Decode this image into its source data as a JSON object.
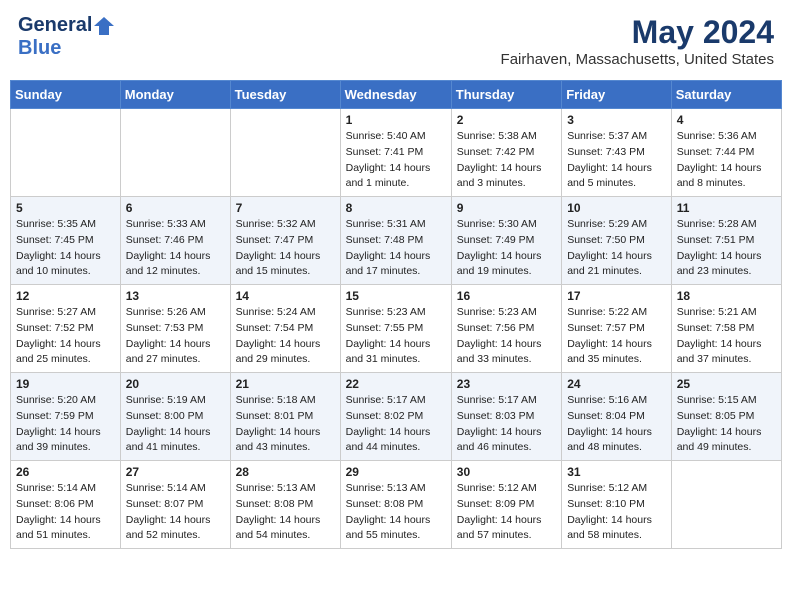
{
  "header": {
    "logo_line1": "General",
    "logo_line2": "Blue",
    "title": "May 2024",
    "subtitle": "Fairhaven, Massachusetts, United States"
  },
  "days_of_week": [
    "Sunday",
    "Monday",
    "Tuesday",
    "Wednesday",
    "Thursday",
    "Friday",
    "Saturday"
  ],
  "weeks": [
    [
      {
        "day": "",
        "info": ""
      },
      {
        "day": "",
        "info": ""
      },
      {
        "day": "",
        "info": ""
      },
      {
        "day": "1",
        "info": "Sunrise: 5:40 AM\nSunset: 7:41 PM\nDaylight: 14 hours\nand 1 minute."
      },
      {
        "day": "2",
        "info": "Sunrise: 5:38 AM\nSunset: 7:42 PM\nDaylight: 14 hours\nand 3 minutes."
      },
      {
        "day": "3",
        "info": "Sunrise: 5:37 AM\nSunset: 7:43 PM\nDaylight: 14 hours\nand 5 minutes."
      },
      {
        "day": "4",
        "info": "Sunrise: 5:36 AM\nSunset: 7:44 PM\nDaylight: 14 hours\nand 8 minutes."
      }
    ],
    [
      {
        "day": "5",
        "info": "Sunrise: 5:35 AM\nSunset: 7:45 PM\nDaylight: 14 hours\nand 10 minutes."
      },
      {
        "day": "6",
        "info": "Sunrise: 5:33 AM\nSunset: 7:46 PM\nDaylight: 14 hours\nand 12 minutes."
      },
      {
        "day": "7",
        "info": "Sunrise: 5:32 AM\nSunset: 7:47 PM\nDaylight: 14 hours\nand 15 minutes."
      },
      {
        "day": "8",
        "info": "Sunrise: 5:31 AM\nSunset: 7:48 PM\nDaylight: 14 hours\nand 17 minutes."
      },
      {
        "day": "9",
        "info": "Sunrise: 5:30 AM\nSunset: 7:49 PM\nDaylight: 14 hours\nand 19 minutes."
      },
      {
        "day": "10",
        "info": "Sunrise: 5:29 AM\nSunset: 7:50 PM\nDaylight: 14 hours\nand 21 minutes."
      },
      {
        "day": "11",
        "info": "Sunrise: 5:28 AM\nSunset: 7:51 PM\nDaylight: 14 hours\nand 23 minutes."
      }
    ],
    [
      {
        "day": "12",
        "info": "Sunrise: 5:27 AM\nSunset: 7:52 PM\nDaylight: 14 hours\nand 25 minutes."
      },
      {
        "day": "13",
        "info": "Sunrise: 5:26 AM\nSunset: 7:53 PM\nDaylight: 14 hours\nand 27 minutes."
      },
      {
        "day": "14",
        "info": "Sunrise: 5:24 AM\nSunset: 7:54 PM\nDaylight: 14 hours\nand 29 minutes."
      },
      {
        "day": "15",
        "info": "Sunrise: 5:23 AM\nSunset: 7:55 PM\nDaylight: 14 hours\nand 31 minutes."
      },
      {
        "day": "16",
        "info": "Sunrise: 5:23 AM\nSunset: 7:56 PM\nDaylight: 14 hours\nand 33 minutes."
      },
      {
        "day": "17",
        "info": "Sunrise: 5:22 AM\nSunset: 7:57 PM\nDaylight: 14 hours\nand 35 minutes."
      },
      {
        "day": "18",
        "info": "Sunrise: 5:21 AM\nSunset: 7:58 PM\nDaylight: 14 hours\nand 37 minutes."
      }
    ],
    [
      {
        "day": "19",
        "info": "Sunrise: 5:20 AM\nSunset: 7:59 PM\nDaylight: 14 hours\nand 39 minutes."
      },
      {
        "day": "20",
        "info": "Sunrise: 5:19 AM\nSunset: 8:00 PM\nDaylight: 14 hours\nand 41 minutes."
      },
      {
        "day": "21",
        "info": "Sunrise: 5:18 AM\nSunset: 8:01 PM\nDaylight: 14 hours\nand 43 minutes."
      },
      {
        "day": "22",
        "info": "Sunrise: 5:17 AM\nSunset: 8:02 PM\nDaylight: 14 hours\nand 44 minutes."
      },
      {
        "day": "23",
        "info": "Sunrise: 5:17 AM\nSunset: 8:03 PM\nDaylight: 14 hours\nand 46 minutes."
      },
      {
        "day": "24",
        "info": "Sunrise: 5:16 AM\nSunset: 8:04 PM\nDaylight: 14 hours\nand 48 minutes."
      },
      {
        "day": "25",
        "info": "Sunrise: 5:15 AM\nSunset: 8:05 PM\nDaylight: 14 hours\nand 49 minutes."
      }
    ],
    [
      {
        "day": "26",
        "info": "Sunrise: 5:14 AM\nSunset: 8:06 PM\nDaylight: 14 hours\nand 51 minutes."
      },
      {
        "day": "27",
        "info": "Sunrise: 5:14 AM\nSunset: 8:07 PM\nDaylight: 14 hours\nand 52 minutes."
      },
      {
        "day": "28",
        "info": "Sunrise: 5:13 AM\nSunset: 8:08 PM\nDaylight: 14 hours\nand 54 minutes."
      },
      {
        "day": "29",
        "info": "Sunrise: 5:13 AM\nSunset: 8:08 PM\nDaylight: 14 hours\nand 55 minutes."
      },
      {
        "day": "30",
        "info": "Sunrise: 5:12 AM\nSunset: 8:09 PM\nDaylight: 14 hours\nand 57 minutes."
      },
      {
        "day": "31",
        "info": "Sunrise: 5:12 AM\nSunset: 8:10 PM\nDaylight: 14 hours\nand 58 minutes."
      },
      {
        "day": "",
        "info": ""
      }
    ]
  ]
}
